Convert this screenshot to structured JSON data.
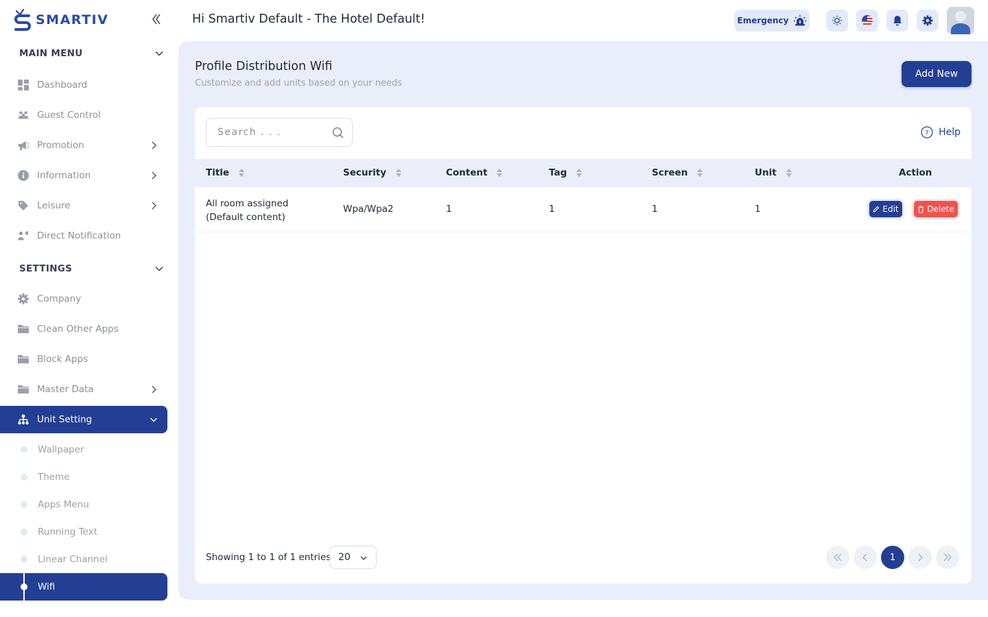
{
  "brand": {
    "name": "SMARTIV"
  },
  "header": {
    "greeting": "Hi Smartiv Default - The Hotel Default!",
    "emergency_label": "Emergency"
  },
  "sidebar": {
    "main_menu_label": "MAIN MENU",
    "main_items": [
      {
        "label": "Dashboard",
        "icon": "grid-icon"
      },
      {
        "label": "Guest Control",
        "icon": "users-icon"
      },
      {
        "label": "Promotion",
        "icon": "megaphone-icon"
      },
      {
        "label": "Information",
        "icon": "info-icon"
      },
      {
        "label": "Leisure",
        "icon": "tag-icon"
      },
      {
        "label": "Direct Notification",
        "icon": "user-notify-icon"
      }
    ],
    "settings_label": "SETTINGS",
    "settings_items": [
      {
        "label": "Company",
        "icon": "gear-icon"
      },
      {
        "label": "Clean Other Apps",
        "icon": "folder-icon"
      },
      {
        "label": "Block Apps",
        "icon": "folder-icon"
      },
      {
        "label": "Master Data",
        "icon": "folder-icon"
      },
      {
        "label": "Unit Setting",
        "icon": "sitemap-icon"
      }
    ],
    "sub_items": [
      {
        "label": "Wallpaper"
      },
      {
        "label": "Theme"
      },
      {
        "label": "Apps Menu"
      },
      {
        "label": "Running Text"
      },
      {
        "label": "Linear Channel"
      },
      {
        "label": "Wifi"
      }
    ]
  },
  "page": {
    "title": "Profile Distribution Wifi",
    "subtitle": "Customize and add units based on your needs",
    "add_label": "Add New"
  },
  "search": {
    "placeholder": "Search . . ."
  },
  "help_label": "Help",
  "table": {
    "columns": [
      "Title",
      "Security",
      "Content",
      "Tag",
      "Screen",
      "Unit",
      "Action"
    ],
    "rows": [
      {
        "title_line1": "All room assigned",
        "title_line2": "(Default content)",
        "security": "Wpa/Wpa2",
        "content": "1",
        "tag": "1",
        "screen": "1",
        "unit": "1"
      }
    ],
    "edit_label": "Edit",
    "delete_label": "Delete"
  },
  "footer": {
    "showing": "Showing 1 to 1 of 1 entries",
    "per_page": "20",
    "current_page": "1"
  },
  "colors": {
    "primary": "#233f94",
    "danger": "#ef5350",
    "surface": "#e9eefa"
  }
}
